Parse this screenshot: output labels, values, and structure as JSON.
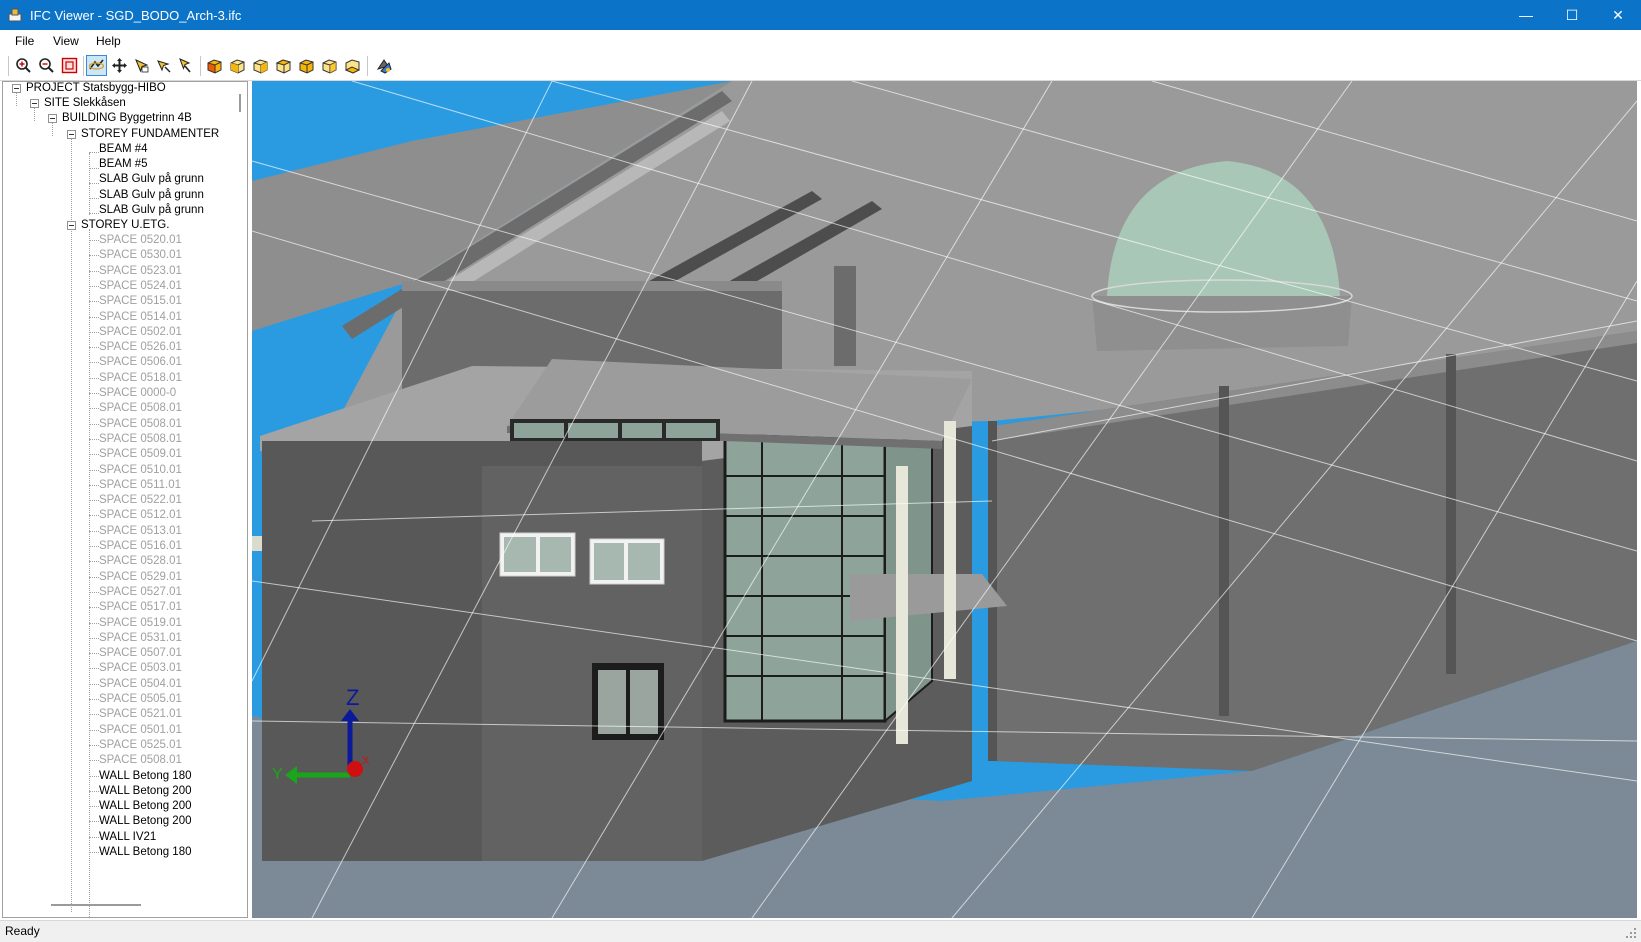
{
  "window": {
    "title": "IFC Viewer - SGD_BODO_Arch-3.ifc",
    "controls": {
      "minimize": "—",
      "maximize": "☐",
      "close": "✕"
    }
  },
  "menu": {
    "file": "File",
    "view": "View",
    "help": "Help"
  },
  "toolbar": {
    "buttons": [
      "zoom-in-icon",
      "zoom-out-icon",
      "zoom-extents-icon",
      "orbit-icon",
      "pan-icon",
      "select-icon",
      "walk-icon",
      "pick-icon",
      "view-iso-icon",
      "view-front-icon",
      "view-back-icon",
      "view-top-icon",
      "view-left-icon",
      "view-right-icon",
      "render-mode-icon"
    ],
    "active": "orbit-icon"
  },
  "tree": {
    "project": "PROJECT Statsbygg-HIBO",
    "site": "SITE Slekkåsen",
    "building": "BUILDING Byggetrinn 4B",
    "storey1": "STOREY FUNDAMENTER",
    "storey1_items": [
      "BEAM #4",
      "BEAM #5",
      "SLAB Gulv på grunn",
      "SLAB Gulv på grunn",
      "SLAB Gulv på grunn"
    ],
    "storey2": "STOREY U.ETG.",
    "spaces": [
      "SPACE 0520.01",
      "SPACE 0530.01",
      "SPACE 0523.01",
      "SPACE 0524.01",
      "SPACE 0515.01",
      "SPACE 0514.01",
      "SPACE 0502.01",
      "SPACE 0526.01",
      "SPACE 0506.01",
      "SPACE 0518.01",
      "SPACE 0000-0",
      "SPACE 0508.01",
      "SPACE 0508.01",
      "SPACE 0508.01",
      "SPACE 0509.01",
      "SPACE 0510.01",
      "SPACE 0511.01",
      "SPACE 0522.01",
      "SPACE 0512.01",
      "SPACE 0513.01",
      "SPACE 0516.01",
      "SPACE 0528.01",
      "SPACE 0529.01",
      "SPACE 0527.01",
      "SPACE 0517.01",
      "SPACE 0519.01",
      "SPACE 0531.01",
      "SPACE 0507.01",
      "SPACE 0503.01",
      "SPACE 0504.01",
      "SPACE 0505.01",
      "SPACE 0521.01",
      "SPACE 0501.01",
      "SPACE 0525.01",
      "SPACE 0508.01"
    ],
    "walls": [
      "WALL Betong 180",
      "WALL Betong 200",
      "WALL Betong 200",
      "WALL Betong 200",
      "WALL IV21",
      "WALL Betong 180"
    ]
  },
  "viewport": {
    "axes": {
      "z": "Z",
      "y": "Y",
      "x": "X"
    },
    "sky_color": "#2a9be0",
    "model_color": "#8a8a8a"
  },
  "status": {
    "text": "Ready"
  }
}
